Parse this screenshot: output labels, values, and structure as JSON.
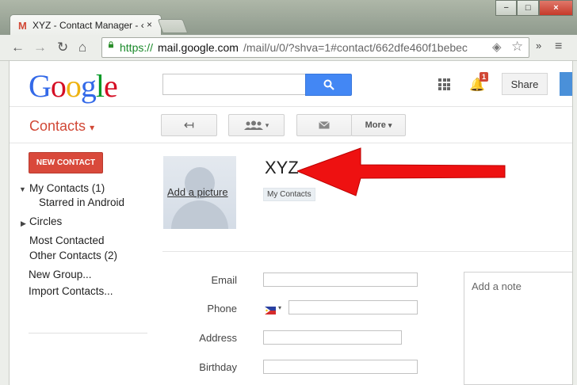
{
  "browser": {
    "tab_title": "XYZ - Contact Manager - ‹",
    "tab_favicon": "M",
    "tab_close": "×",
    "window_controls": {
      "minimize": "−",
      "maximize": "□",
      "close": "×"
    },
    "url": {
      "scheme": "https://",
      "host": "mail.google.com",
      "path": "/mail/u/0/?shva=1#contact/662dfe460f1bebec"
    },
    "nav": {
      "back": "←",
      "forward": "→",
      "reload": "↻",
      "home": "⌂"
    },
    "overflow": "»",
    "menu": "≡"
  },
  "header": {
    "logo": [
      "G",
      "o",
      "o",
      "g",
      "l",
      "e"
    ],
    "logo_colors": [
      "#3369e8",
      "#d50f25",
      "#eeb211",
      "#3369e8",
      "#009925",
      "#d50f25"
    ],
    "search_placeholder": "",
    "notification_count": "1",
    "share_label": "Share"
  },
  "toolbar": {
    "app_title": "Contacts",
    "app_caret": "▾",
    "back_icon": "↤",
    "more_label": "More",
    "caret": "▾"
  },
  "sidebar": {
    "new_contact_label": "NEW CONTACT",
    "my_contacts": "My Contacts (1)",
    "starred": "Starred in Android",
    "circles": "Circles",
    "most_contacted": "Most Contacted",
    "other_contacts": "Other Contacts (2)",
    "new_group": "New Group...",
    "import_contacts": "Import Contacts...",
    "expanded_marker": "▼",
    "collapsed_marker": "▶"
  },
  "contact": {
    "name": "XYZ",
    "add_picture": "Add a picture",
    "group": "My Contacts",
    "fields": {
      "email_label": "Email",
      "phone_label": "Phone",
      "address_label": "Address",
      "birthday_label": "Birthday"
    },
    "note_placeholder": "Add a note"
  },
  "colors": {
    "accent_red": "#d14836",
    "search_blue": "#4387f4",
    "annotation_arrow": "#ee1111"
  }
}
